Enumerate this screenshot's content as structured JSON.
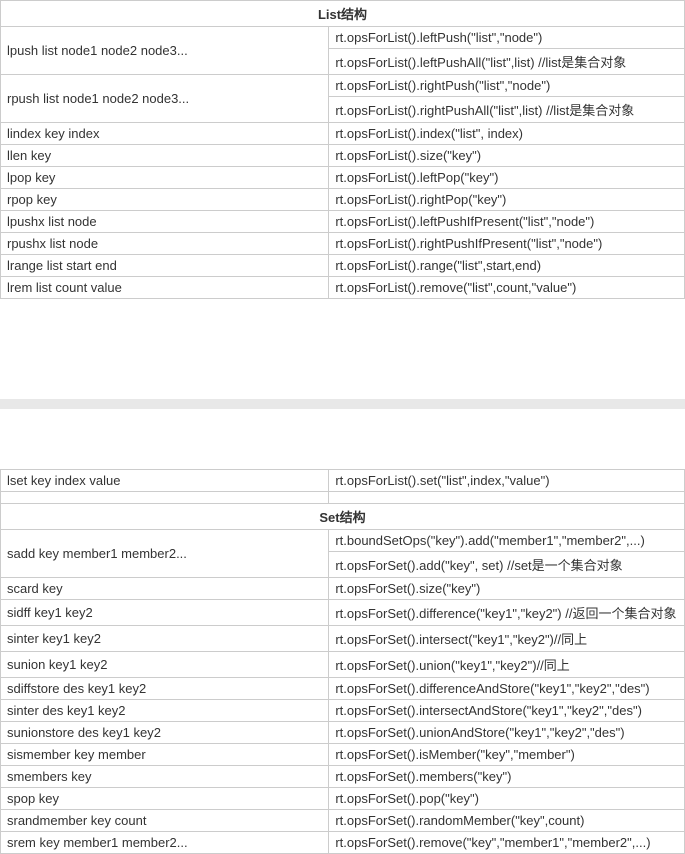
{
  "table1": {
    "header": "List结构",
    "rows": [
      {
        "left": "lpush list node1 node2 node3...",
        "right": [
          "rt.opsForList().leftPush(\"list\",\"node\")",
          "rt.opsForList().leftPushAll(\"list\",list) //list是集合对象"
        ],
        "rowspan": 2
      },
      {
        "left": "rpush list node1 node2 node3...",
        "right": [
          "rt.opsForList().rightPush(\"list\",\"node\")",
          "rt.opsForList().rightPushAll(\"list\",list) //list是集合对象"
        ],
        "rowspan": 2
      },
      {
        "left": "lindex key index",
        "right": [
          "rt.opsForList().index(\"list\", index)"
        ]
      },
      {
        "left": "llen key",
        "right": [
          "rt.opsForList().size(\"key\")"
        ]
      },
      {
        "left": "lpop key",
        "right": [
          "rt.opsForList().leftPop(\"key\")"
        ]
      },
      {
        "left": "rpop key",
        "right": [
          "rt.opsForList().rightPop(\"key\")"
        ]
      },
      {
        "left": "lpushx list node",
        "right": [
          "rt.opsForList().leftPushIfPresent(\"list\",\"node\")"
        ]
      },
      {
        "left": "rpushx list node",
        "right": [
          "rt.opsForList().rightPushIfPresent(\"list\",\"node\")"
        ]
      },
      {
        "left": "lrange list start end",
        "right": [
          "rt.opsForList().range(\"list\",start,end)"
        ]
      },
      {
        "left": "lrem list count value",
        "right": [
          "rt.opsForList().remove(\"list\",count,\"value\")"
        ]
      }
    ]
  },
  "table2": {
    "extra_row": {
      "left": "lset key index value",
      "right": "rt.opsForList().set(\"list\",index,\"value\")"
    },
    "header": "Set结构",
    "rows": [
      {
        "left": "sadd key member1 member2...",
        "right": [
          "rt.boundSetOps(\"key\").add(\"member1\",\"member2\",...)",
          "rt.opsForSet().add(\"key\", set) //set是一个集合对象"
        ],
        "rowspan": 2
      },
      {
        "left": "scard key",
        "right": [
          "rt.opsForSet().size(\"key\")"
        ]
      },
      {
        "left": "sidff key1 key2",
        "right": [
          "rt.opsForSet().difference(\"key1\",\"key2\") //返回一个集合对象"
        ]
      },
      {
        "left": "sinter key1 key2",
        "right": [
          "rt.opsForSet().intersect(\"key1\",\"key2\")//同上"
        ]
      },
      {
        "left": "sunion key1 key2",
        "right": [
          "rt.opsForSet().union(\"key1\",\"key2\")//同上"
        ]
      },
      {
        "left": "sdiffstore des key1 key2",
        "right": [
          "rt.opsForSet().differenceAndStore(\"key1\",\"key2\",\"des\")"
        ]
      },
      {
        "left": "sinter des key1 key2",
        "right": [
          "rt.opsForSet().intersectAndStore(\"key1\",\"key2\",\"des\")"
        ]
      },
      {
        "left": "sunionstore des key1 key2",
        "right": [
          "rt.opsForSet().unionAndStore(\"key1\",\"key2\",\"des\")"
        ]
      },
      {
        "left": "sismember key member",
        "right": [
          "rt.opsForSet().isMember(\"key\",\"member\")"
        ]
      },
      {
        "left": "smembers key",
        "right": [
          "rt.opsForSet().members(\"key\")"
        ]
      },
      {
        "left": "spop key",
        "right": [
          "rt.opsForSet().pop(\"key\")"
        ]
      },
      {
        "left": "srandmember key count",
        "right": [
          "rt.opsForSet().randomMember(\"key\",count)"
        ]
      },
      {
        "left": "srem key member1 member2...",
        "right": [
          "rt.opsForSet().remove(\"key\",\"member1\",\"member2\",...)"
        ]
      }
    ]
  }
}
